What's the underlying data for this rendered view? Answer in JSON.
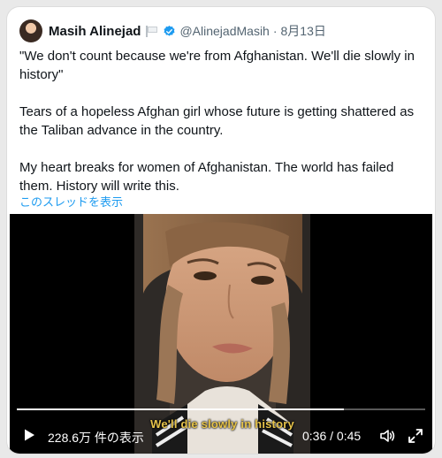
{
  "tweet": {
    "display_name": "Masih Alinejad",
    "handle": "@AlinejadMasih",
    "separator": "·",
    "date": "8月13日",
    "paragraphs": [
      "\"We don't count because we're from Afghanistan. We'll die slowly in history\"",
      "Tears of a hopeless Afghan girl whose future is getting shattered as the Taliban advance in the country.",
      "My heart breaks for women of Afghanistan. The world has failed them. History will write this."
    ],
    "thread_link": "このスレッドを表示"
  },
  "video": {
    "subtitle": "We'll die slowly in history",
    "views": "228.6万 件の表示",
    "current_time": "0:36",
    "time_separator": " / ",
    "duration": "0:45",
    "progress": 0.8
  },
  "icons": {
    "verified": "verified-badge-icon",
    "flag": "white-flag-icon",
    "play": "play-icon",
    "volume": "volume-icon",
    "fullscreen": "fullscreen-icon"
  },
  "colors": {
    "link": "#1d9bf0",
    "verified": "#1d9bf0",
    "subtitle": "#e6c34a",
    "video_bg": "#000000"
  }
}
